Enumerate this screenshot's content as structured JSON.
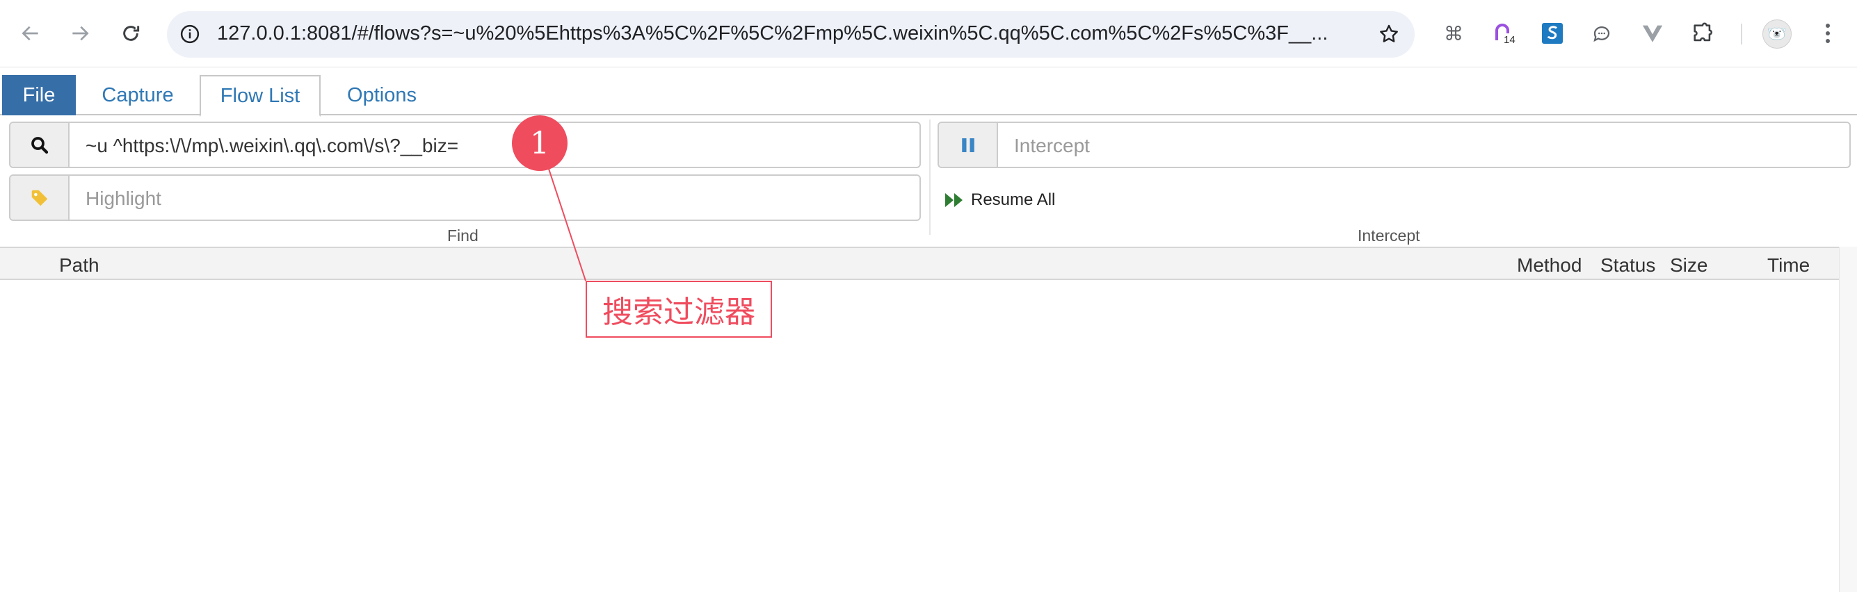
{
  "browser": {
    "url": "127.0.0.1:8081/#/flows?s=~u%20%5Ehttps%3A%5C%2F%5C%2Fmp%5C.weixin%5C.qq%5C.com%5C%2Fs%5C%3F__...",
    "extension_badge": "14"
  },
  "app": {
    "tabs": [
      {
        "label": "File",
        "active": false,
        "highlight": true
      },
      {
        "label": "Capture",
        "active": false
      },
      {
        "label": "Flow List",
        "active": true
      },
      {
        "label": "Options",
        "active": false
      }
    ],
    "find": {
      "search_value": "~u ^https:\\/\\/mp\\.weixin\\.qq\\.com\\/s\\?__biz=",
      "highlight_placeholder": "Highlight",
      "group_label": "Find"
    },
    "intercept": {
      "placeholder": "Intercept",
      "resume_all_label": "Resume All",
      "group_label": "Intercept"
    },
    "table": {
      "columns": [
        "Path",
        "Method",
        "Status",
        "Size",
        "Time"
      ],
      "rows": []
    }
  },
  "annotation": {
    "number": "1",
    "text": "搜索过滤器",
    "color": "#ef4c5e"
  },
  "colors": {
    "file_tab_bg": "#366ea7",
    "tab_text": "#2f78b5",
    "resume_icon": "#2e7d32",
    "highlight_icon": "#f2c037"
  }
}
